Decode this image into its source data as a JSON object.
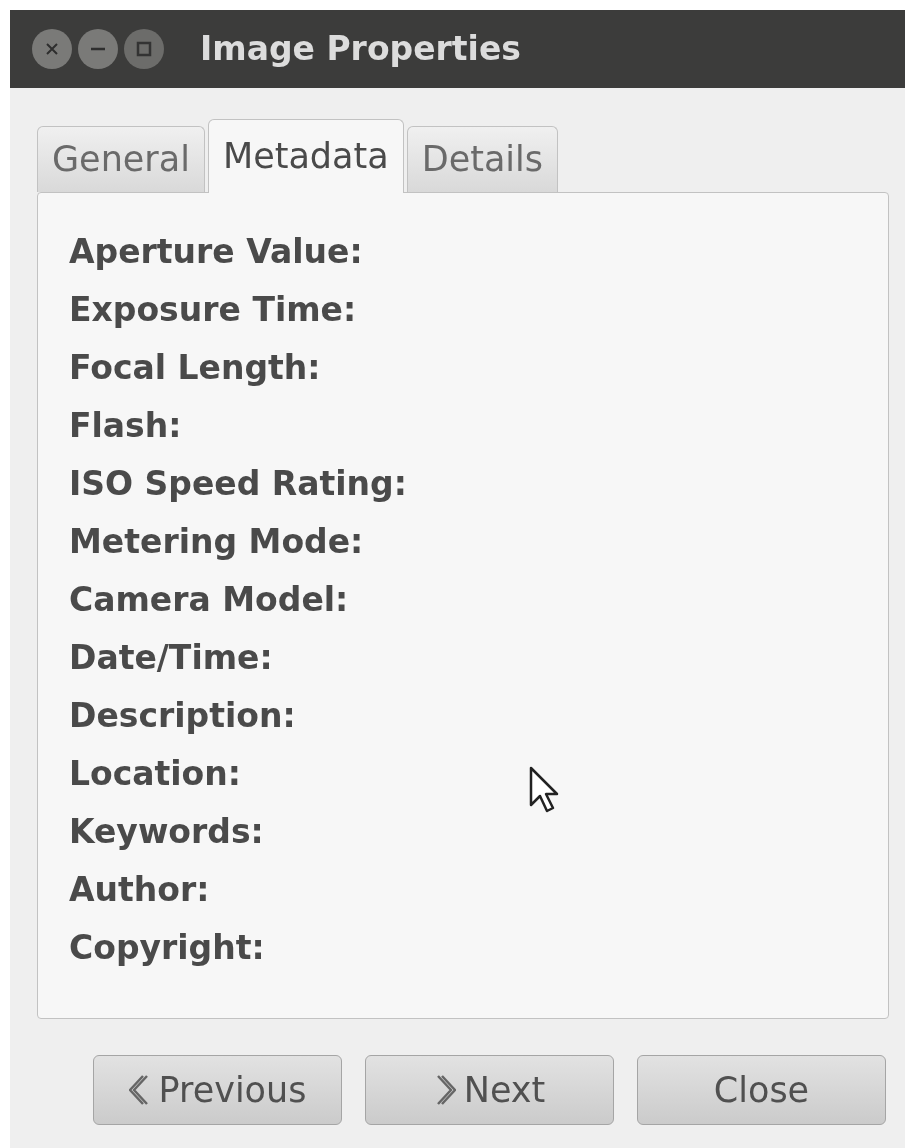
{
  "window": {
    "title": "Image Properties"
  },
  "tabs": [
    {
      "label": "General",
      "selected": false
    },
    {
      "label": "Metadata",
      "selected": true
    },
    {
      "label": "Details",
      "selected": false
    }
  ],
  "fields": [
    "Aperture Value:",
    "Exposure Time:",
    "Focal Length:",
    "Flash:",
    "ISO Speed Rating:",
    "Metering Mode:",
    "Camera Model:",
    "Date/Time:",
    "Description:",
    "Location:",
    "Keywords:",
    "Author:",
    "Copyright:"
  ],
  "buttons": [
    {
      "label": "Previous",
      "kind": "previous"
    },
    {
      "label": "Next",
      "kind": "next"
    },
    {
      "label": "Close",
      "kind": "plain"
    }
  ]
}
